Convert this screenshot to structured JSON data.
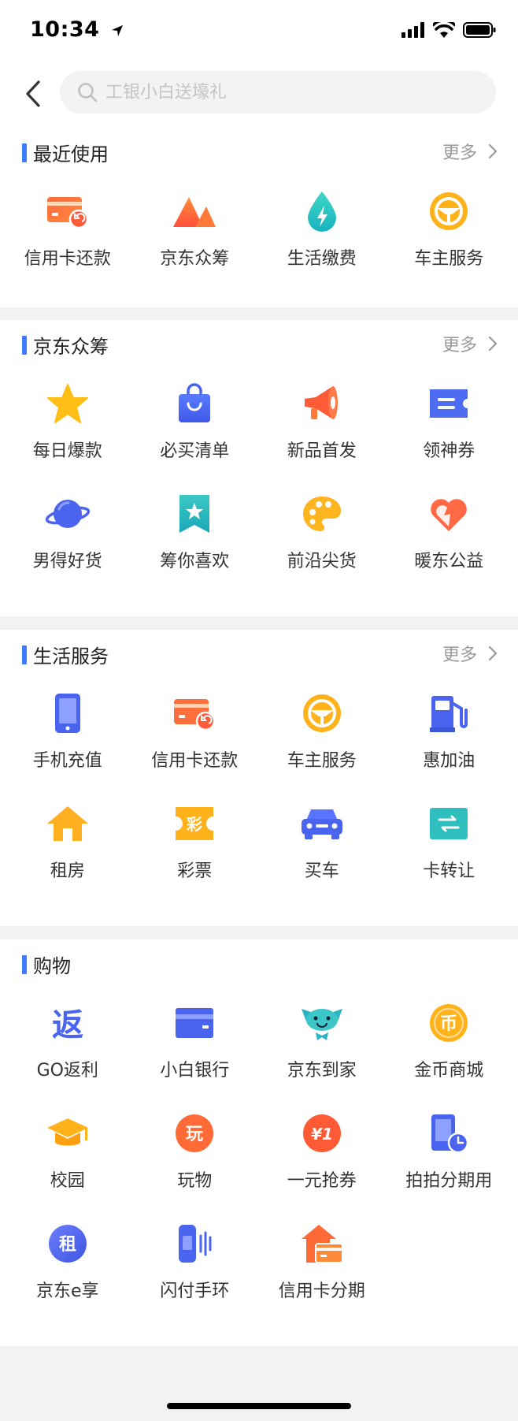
{
  "status": {
    "time": "10:34"
  },
  "search": {
    "placeholder": "工银小白送壕礼"
  },
  "sections": [
    {
      "title": "最近使用",
      "more": "更多",
      "items": [
        {
          "label": "信用卡还款",
          "icon": "credit-card-repay-icon"
        },
        {
          "label": "京东众筹",
          "icon": "crowdfund-mountain-icon"
        },
        {
          "label": "生活缴费",
          "icon": "utility-drop-icon"
        },
        {
          "label": "车主服务",
          "icon": "steering-wheel-icon"
        }
      ]
    },
    {
      "title": "京东众筹",
      "more": "更多",
      "items": [
        {
          "label": "每日爆款",
          "icon": "star-icon"
        },
        {
          "label": "必买清单",
          "icon": "shopping-bag-icon"
        },
        {
          "label": "新品首发",
          "icon": "megaphone-icon"
        },
        {
          "label": "领神券",
          "icon": "coupon-ticket-icon"
        },
        {
          "label": "男得好货",
          "icon": "planet-icon"
        },
        {
          "label": "筹你喜欢",
          "icon": "bookmark-star-icon"
        },
        {
          "label": "前沿尖货",
          "icon": "palette-icon"
        },
        {
          "label": "暖东公益",
          "icon": "heart-icon"
        }
      ]
    },
    {
      "title": "生活服务",
      "more": "更多",
      "items": [
        {
          "label": "手机充值",
          "icon": "phone-icon"
        },
        {
          "label": "信用卡还款",
          "icon": "credit-card-repay-icon"
        },
        {
          "label": "车主服务",
          "icon": "steering-wheel-icon"
        },
        {
          "label": "惠加油",
          "icon": "gas-pump-icon"
        },
        {
          "label": "租房",
          "icon": "house-icon"
        },
        {
          "label": "彩票",
          "icon": "lottery-icon"
        },
        {
          "label": "买车",
          "icon": "car-icon"
        },
        {
          "label": "卡转让",
          "icon": "card-transfer-icon"
        }
      ]
    },
    {
      "title": "购物",
      "items": [
        {
          "label": "GO返利",
          "icon": "rebate-icon"
        },
        {
          "label": "小白银行",
          "icon": "bank-card-icon"
        },
        {
          "label": "京东到家",
          "icon": "dog-mascot-icon"
        },
        {
          "label": "金币商城",
          "icon": "gold-coin-icon"
        },
        {
          "label": "校园",
          "icon": "graduation-cap-icon"
        },
        {
          "label": "玩物",
          "icon": "play-badge-icon"
        },
        {
          "label": "一元抢券",
          "icon": "yuan-coupon-icon"
        },
        {
          "label": "拍拍分期用",
          "icon": "phone-clock-icon"
        },
        {
          "label": "京东e享",
          "icon": "rent-badge-icon"
        },
        {
          "label": "闪付手环",
          "icon": "wristband-icon"
        },
        {
          "label": "信用卡分期",
          "icon": "card-home-icon"
        }
      ]
    }
  ],
  "glyphs": {
    "lottery": "彩",
    "rebate": "返",
    "coin": "币",
    "play": "玩",
    "yuan_one": "¥1",
    "rent": "租"
  }
}
